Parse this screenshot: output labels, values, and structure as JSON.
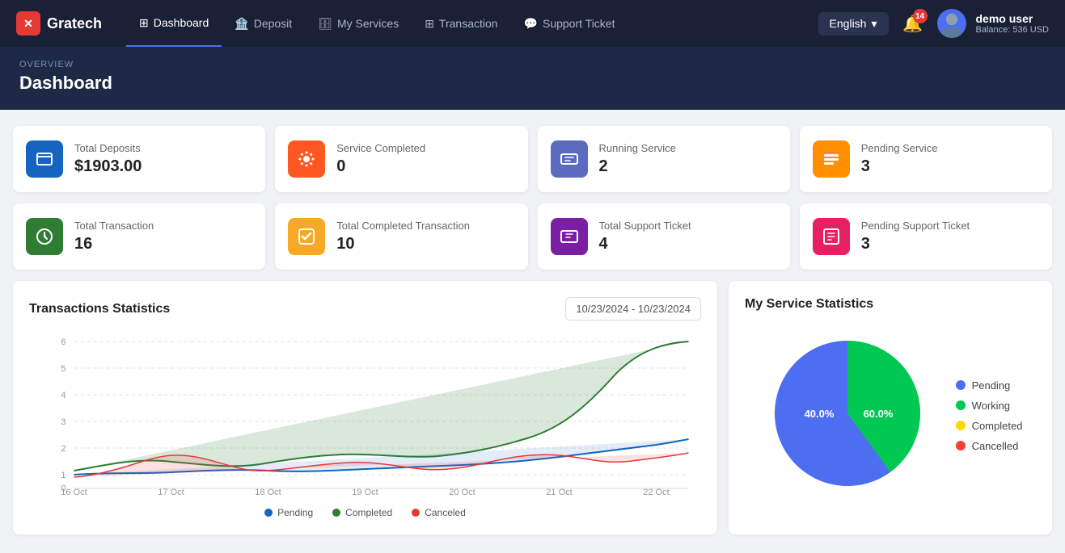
{
  "brand": {
    "name": "Gratech",
    "icon_text": "X"
  },
  "nav": {
    "links": [
      {
        "label": "Dashboard",
        "icon": "⊞",
        "active": true
      },
      {
        "label": "Deposit",
        "icon": "🏦",
        "active": false
      },
      {
        "label": "My Services",
        "icon": "🗄",
        "active": false
      },
      {
        "label": "Transaction",
        "icon": "⊞",
        "active": false
      },
      {
        "label": "Support Ticket",
        "icon": "💬",
        "active": false
      }
    ],
    "language": "English",
    "notif_count": "14",
    "user_name": "demo user",
    "user_balance": "Balance: 536 USD"
  },
  "header": {
    "breadcrumb": "OVERVIEW",
    "title": "Dashboard"
  },
  "stat_cards_row1": [
    {
      "label": "Total Deposits",
      "value": "$1903.00",
      "icon": "📋",
      "icon_class": "icon-blue"
    },
    {
      "label": "Service Completed",
      "value": "0",
      "icon": "⚙",
      "icon_class": "icon-red-light"
    },
    {
      "label": "Running Service",
      "value": "2",
      "icon": "🗂",
      "icon_class": "icon-indigo"
    },
    {
      "label": "Pending Service",
      "value": "3",
      "icon": "📤",
      "icon_class": "icon-orange"
    }
  ],
  "stat_cards_row2": [
    {
      "label": "Total Transaction",
      "value": "16",
      "icon": "📎",
      "icon_class": "icon-green"
    },
    {
      "label": "Total Completed Transaction",
      "value": "10",
      "icon": "↔",
      "icon_class": "icon-yellow"
    },
    {
      "label": "Total Support Ticket",
      "value": "4",
      "icon": "🎫",
      "icon_class": "icon-purple"
    },
    {
      "label": "Pending Support Ticket",
      "value": "3",
      "icon": "[ ]",
      "icon_class": "icon-pink"
    }
  ],
  "transactions_chart": {
    "title": "Transactions Statistics",
    "date_range": "10/23/2024 - 10/23/2024",
    "legend": [
      {
        "label": "Pending",
        "color": "#1565c0"
      },
      {
        "label": "Completed",
        "color": "#2e7d32"
      },
      {
        "label": "Canceled",
        "color": "#e53935"
      }
    ],
    "x_labels": [
      "16 Oct",
      "17 Oct",
      "18 Oct",
      "19 Oct",
      "20 Oct",
      "21 Oct",
      "22 Oct"
    ],
    "y_labels": [
      "0",
      "1",
      "2",
      "3",
      "4",
      "5",
      "6"
    ]
  },
  "service_chart": {
    "title": "My Service Statistics",
    "legend": [
      {
        "label": "Pending",
        "color": "#4e6ef2"
      },
      {
        "label": "Working",
        "color": "#00c853"
      },
      {
        "label": "Completed",
        "color": "#ffd600"
      },
      {
        "label": "Cancelled",
        "color": "#f44336"
      }
    ],
    "slices": [
      {
        "label": "Working",
        "percent": 40.0,
        "color": "#00c853"
      },
      {
        "label": "Pending",
        "percent": 60.0,
        "color": "#4e6ef2"
      }
    ]
  }
}
